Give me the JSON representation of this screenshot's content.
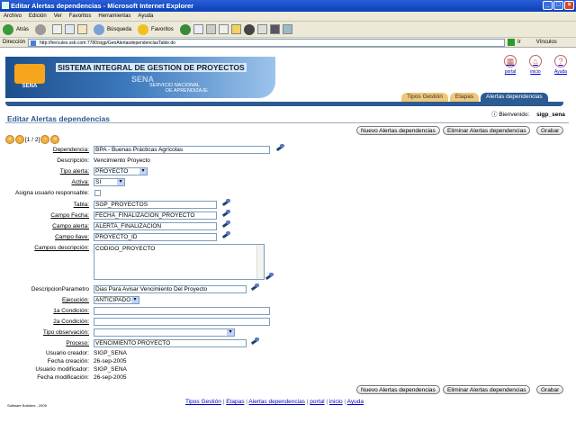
{
  "window": {
    "title": "Editar Alertas dependencias - Microsoft Internet Explorer"
  },
  "menu": [
    "Archivo",
    "Edición",
    "Ver",
    "Favoritos",
    "Herramientas",
    "Ayuda"
  ],
  "toolbar": {
    "back": "Atrás",
    "search": "Búsqueda",
    "favorites": "Favoritos"
  },
  "address": {
    "label": "Dirección",
    "url": "http://hercules.xsb.com:7780/sigp/GenAlertasdependenciasTable.do",
    "go": "Ir",
    "links": "Vínculos"
  },
  "banner": {
    "logo_text": "SENA",
    "system": "SISTEMA INTEGRAL DE GESTION DE PROYECTOS",
    "sena": "SENA",
    "servicio": "SERVICIO NACIONAL",
    "aprendizaje": "DE APRENDIZAJE"
  },
  "topnav": {
    "portal": "portal",
    "inicio": "inicio",
    "ayuda": "Ayuda"
  },
  "tabs": [
    "Tipos Gestión",
    "Etapas",
    "Alertas dependencias"
  ],
  "page": {
    "title": "Editar Alertas dependencias",
    "welcome_label": "Bienvenido:",
    "user": "sigp_sena"
  },
  "buttons": {
    "nuevo": "Nuevo Alertas dependencias",
    "eliminar": "Eliminar Alertas dependencias",
    "grabar": "Grabar"
  },
  "nav": {
    "pager": "[1 / 2]"
  },
  "form": {
    "dependencia": {
      "label": "Dependencia:",
      "value": "BPA - Buenas Prácticas Agrícolas"
    },
    "descripcion": {
      "label": "Descripción:",
      "value": "Vencimiento Proyecto"
    },
    "tipo_alerta": {
      "label": "Tipo alerta:",
      "value": "PROYECTO"
    },
    "activa": {
      "label": "Activa:",
      "value": "SI"
    },
    "asigna": {
      "label": "Asigna usuario responsable:"
    },
    "tabla": {
      "label": "Tabla:",
      "value": "SGP_PROYECTOS"
    },
    "campo_fecha": {
      "label": "Campo Fecha:",
      "value": "FECHA_FINALIZACION_PROYECTO"
    },
    "campo_alerta": {
      "label": "Campo alerta:",
      "value": "ALERTA_FINALIZACION"
    },
    "campo_llave": {
      "label": "Campo llave:",
      "value": "PROYECTO_ID"
    },
    "campos_descripcion": {
      "label": "Campos descripción:",
      "value": "CODIGO_PROYECTO"
    },
    "descripcion_parametro": {
      "label": "DescripcionParametro",
      "value": "Dias Para Avisar Vencimiento Del Proyecto"
    },
    "ejecucion": {
      "label": "Ejecución:",
      "value": "ANTICIPADO"
    },
    "condicion1": {
      "label": "1a Condición:",
      "value": ""
    },
    "condicion2": {
      "label": "2a Condición:",
      "value": ""
    },
    "tipo_observacion": {
      "label": "Tipo observación:",
      "value": ""
    },
    "proceso": {
      "label": "Proceso:",
      "value": "VENCIMIENTO PROYECTO"
    },
    "usuario_creador": {
      "label": "Usuario creador:",
      "value": "SIGP_SENA"
    },
    "fecha_creacion": {
      "label": "Fecha creación:",
      "value": "26-sep-2005"
    },
    "usuario_modificador": {
      "label": "Usuario modificador:",
      "value": "SIGP_SENA"
    },
    "fecha_modificacion": {
      "label": "Fecha modificación:",
      "value": "26-sep-2005"
    }
  },
  "footer": {
    "links": [
      "Tipos Gestión",
      "Etapas",
      "Alertas dependencias",
      "portal",
      "inicio",
      "Ayuda"
    ],
    "sep": "|",
    "copyright": "Software Builders - 2005"
  }
}
